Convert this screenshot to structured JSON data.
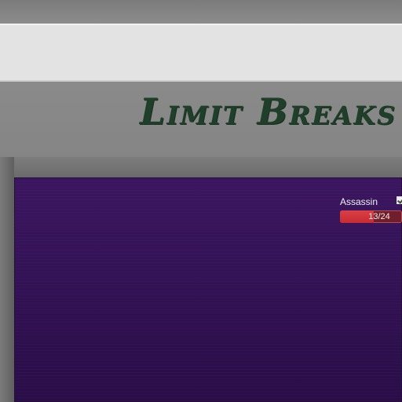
{
  "header": {
    "title": "Limit Breaks"
  },
  "limit_break": {
    "name": "Assassin",
    "progress_text": "13/24",
    "current": 13,
    "maximum": 24,
    "progress_fraction": 0.5417,
    "checked": true
  },
  "colors": {
    "title": "#1f3f2a",
    "panel_top": "#3b1660",
    "panel_bottom": "#2a0d48",
    "progress_fill": "#d84045",
    "progress_track": "#6f1e2b"
  }
}
